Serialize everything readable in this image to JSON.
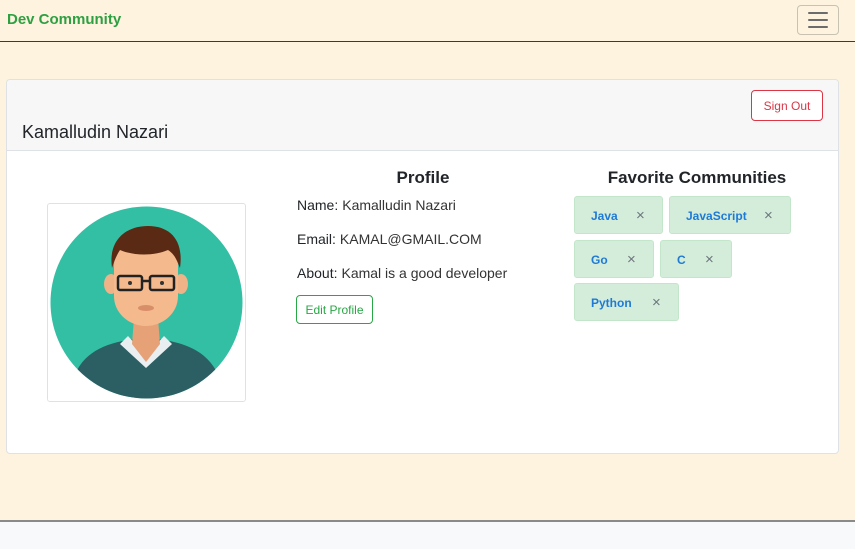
{
  "navbar": {
    "brand": "Dev Community",
    "toggler_icon": "hamburger-menu-icon"
  },
  "profile_card": {
    "header_name": "Kamalludin Nazari",
    "signout_label": "Sign Out",
    "avatar": "male-developer-avatar-with-glasses",
    "profile_heading": "Profile",
    "name_label": "Name:",
    "name_value": "Kamalludin Nazari",
    "email_label": "Email:",
    "email_value": "KAMAL@GMAIL.COM",
    "about_label": "About:",
    "about_value": "Kamal is a good developer",
    "edit_label": "Edit Profile"
  },
  "favorites": {
    "heading": "Favorite Communities",
    "items": [
      {
        "label": "Java",
        "close": "×"
      },
      {
        "label": "JavaScript",
        "close": "×"
      },
      {
        "label": "Go",
        "close": "×"
      },
      {
        "label": "C",
        "close": "×"
      },
      {
        "label": "Python",
        "close": "×"
      }
    ]
  },
  "colors": {
    "page_bg": "#fdf3df",
    "brand": "#2ea043",
    "signout": "#dc3545",
    "edit": "#28a745",
    "chip_bg": "#d4edda",
    "chip_text": "#1e7ad6"
  }
}
